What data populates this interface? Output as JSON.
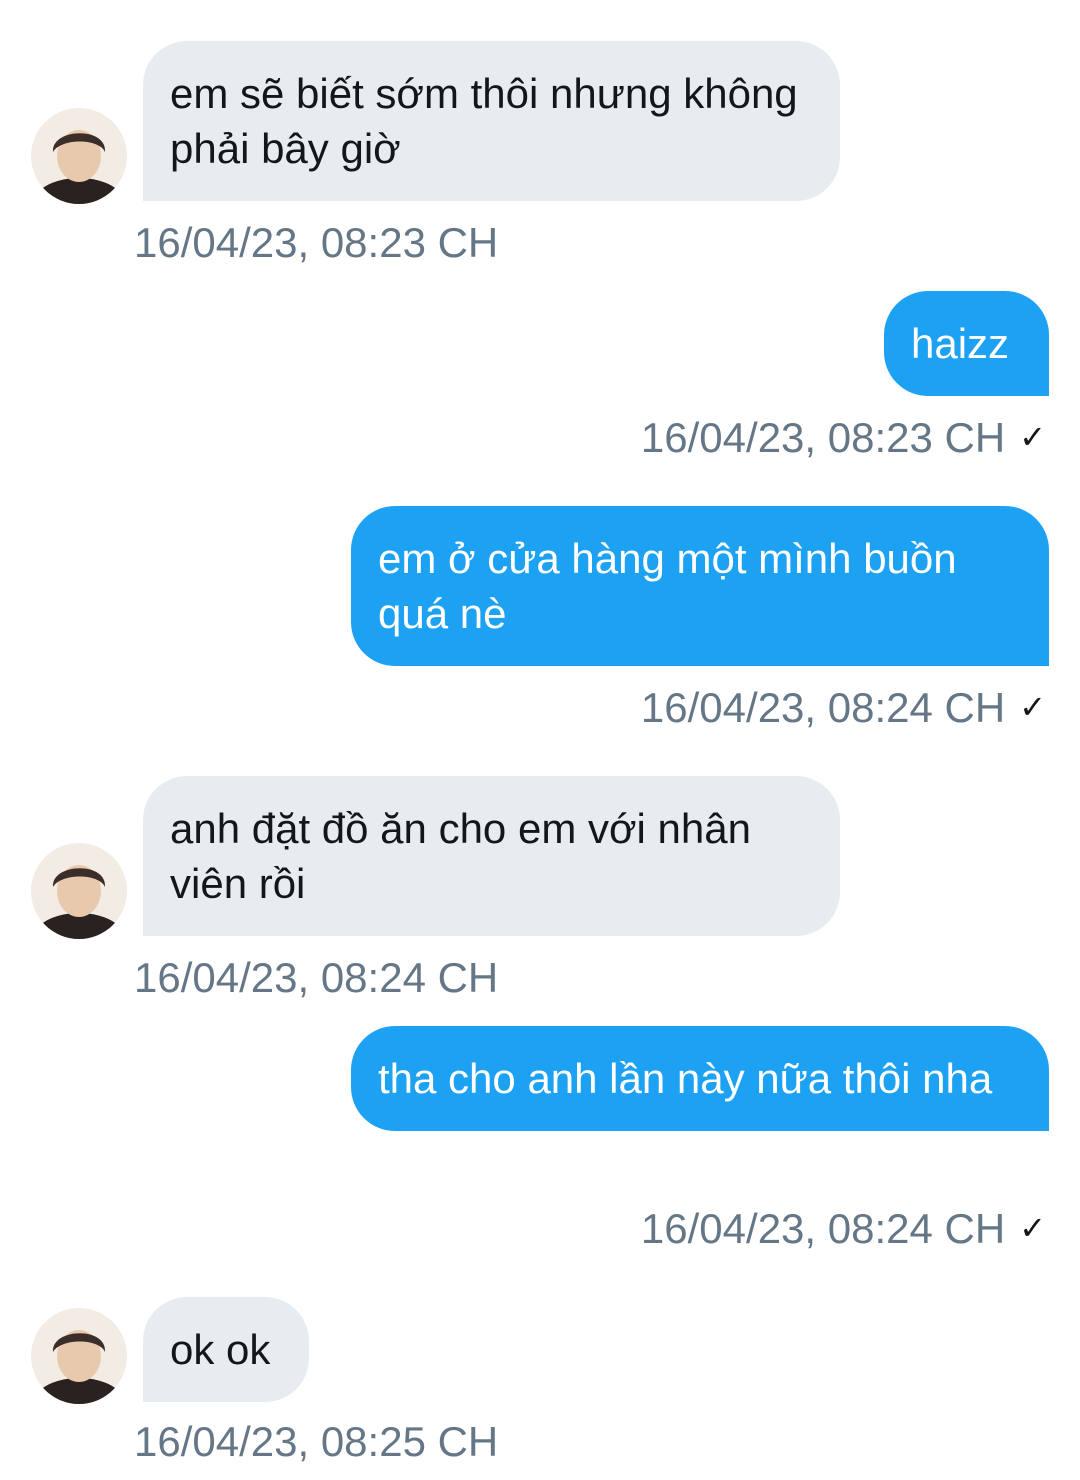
{
  "messages": [
    {
      "direction": "incoming",
      "text": "em sẽ biết sớm thôi nhưng không phải bây giờ",
      "time": "16/04/23, 08:23 CH"
    },
    {
      "direction": "outgoing",
      "text": "haizz",
      "time": "16/04/23, 08:23 CH",
      "status": "sent"
    },
    {
      "direction": "outgoing",
      "text": "em ở cửa hàng một mình buồn quá nè",
      "time": "16/04/23, 08:24 CH",
      "status": "sent"
    },
    {
      "direction": "incoming",
      "text": "anh đặt đồ ăn cho em với nhân viên rồi",
      "time": "16/04/23, 08:24 CH"
    },
    {
      "direction": "outgoing",
      "text": "tha cho anh lần này nữa thôi nha",
      "time": "16/04/23, 08:24 CH",
      "status": "sent"
    },
    {
      "direction": "incoming",
      "text": "ok ok",
      "time": "16/04/23, 08:25 CH"
    }
  ],
  "icons": {
    "avatar": "contact-avatar",
    "sent": "checkmark-icon"
  },
  "colors": {
    "incoming_bubble": "#e6ecf0",
    "outgoing_bubble": "#1da1f2",
    "timestamp": "#657786"
  }
}
